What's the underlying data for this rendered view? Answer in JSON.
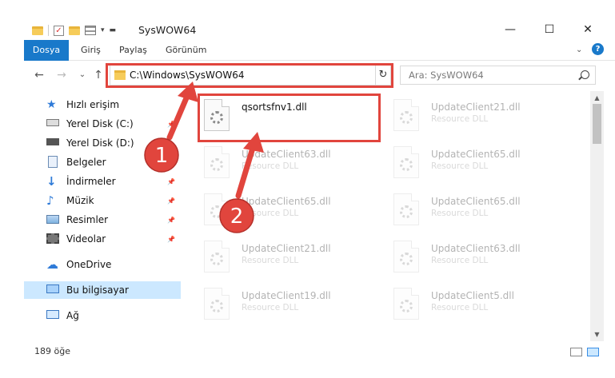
{
  "window": {
    "title": "SysWOW64",
    "minimize_glyph": "—",
    "maximize_glyph": "☐",
    "close_glyph": "✕"
  },
  "ribbon": {
    "tabs": [
      "Dosya",
      "Giriş",
      "Paylaş",
      "Görünüm"
    ],
    "expand_glyph": "⌄",
    "help_glyph": "?"
  },
  "nav": {
    "back_glyph": "←",
    "forward_glyph": "→",
    "recent_glyph": "⌄",
    "up_glyph": "↑",
    "address": "C:\\Windows\\SysWOW64",
    "address_dropdown_glyph": "⌄",
    "refresh_glyph": "↻",
    "search_placeholder": "Ara: SysWOW64"
  },
  "sidebar": {
    "items": [
      {
        "label": "Hızlı erişim",
        "icon": "star-icon"
      },
      {
        "label": "Yerel Disk (C:)",
        "icon": "drive-icon"
      },
      {
        "label": "Yerel Disk (D:)",
        "icon": "drive-icon"
      },
      {
        "label": "Belgeler",
        "icon": "document-icon"
      },
      {
        "label": "İndirmeler",
        "icon": "download-icon"
      },
      {
        "label": "Müzik",
        "icon": "music-icon"
      },
      {
        "label": "Resimler",
        "icon": "pictures-icon"
      },
      {
        "label": "Videolar",
        "icon": "video-icon"
      },
      {
        "label": "OneDrive",
        "icon": "cloud-icon"
      },
      {
        "label": "Bu bilgisayar",
        "icon": "computer-icon"
      },
      {
        "label": "Ağ",
        "icon": "network-icon"
      }
    ],
    "pin_glyph": "📌"
  },
  "files": {
    "highlighted": {
      "name": "qsortsfnv1.dll",
      "type": ""
    },
    "items": [
      {
        "name": "UpdateClient21.dll",
        "type": "Resource DLL"
      },
      {
        "name": "UpdateClient63.dll",
        "type": "Resource DLL"
      },
      {
        "name": "UpdateClient65.dll",
        "type": "Resource DLL"
      },
      {
        "name": "UpdateClient65.dll",
        "type": "Resource DLL"
      },
      {
        "name": "UpdateClient65.dll",
        "type": "Resource DLL"
      },
      {
        "name": "UpdateClient21.dll",
        "type": "Resource DLL"
      },
      {
        "name": "UpdateClient63.dll",
        "type": "Resource DLL"
      },
      {
        "name": "UpdateClient19.dll",
        "type": "Resource DLL"
      },
      {
        "name": "UpdateClient5.dll",
        "type": "Resource DLL"
      }
    ]
  },
  "status": {
    "count": "189 öğe"
  },
  "annotations": {
    "step1": "1",
    "step2": "2",
    "accent": "#e1453d"
  }
}
